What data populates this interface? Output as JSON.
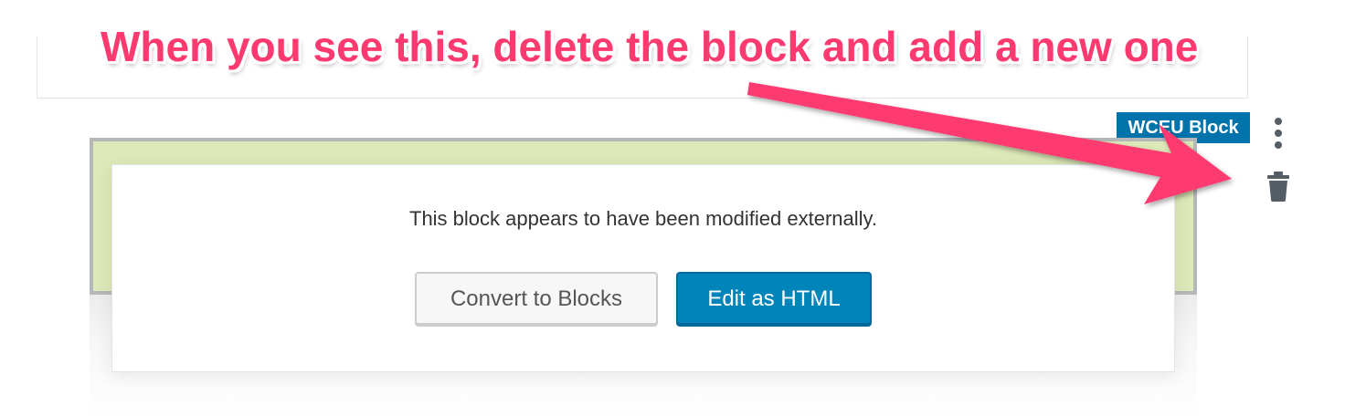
{
  "annotation": {
    "headline": "When you see this, delete the block and add a new one",
    "color": "#fd3a6f"
  },
  "block": {
    "badge_label": "WCEU Block",
    "badge_color": "#0073aa",
    "background_color": "#dde9b8",
    "more_icon": "vertical-ellipsis",
    "delete_icon": "trash"
  },
  "warning": {
    "message": "This block appears to have been modified externally.",
    "convert_label": "Convert to Blocks",
    "edit_label": "Edit as HTML",
    "edit_color": "#0085ba"
  }
}
